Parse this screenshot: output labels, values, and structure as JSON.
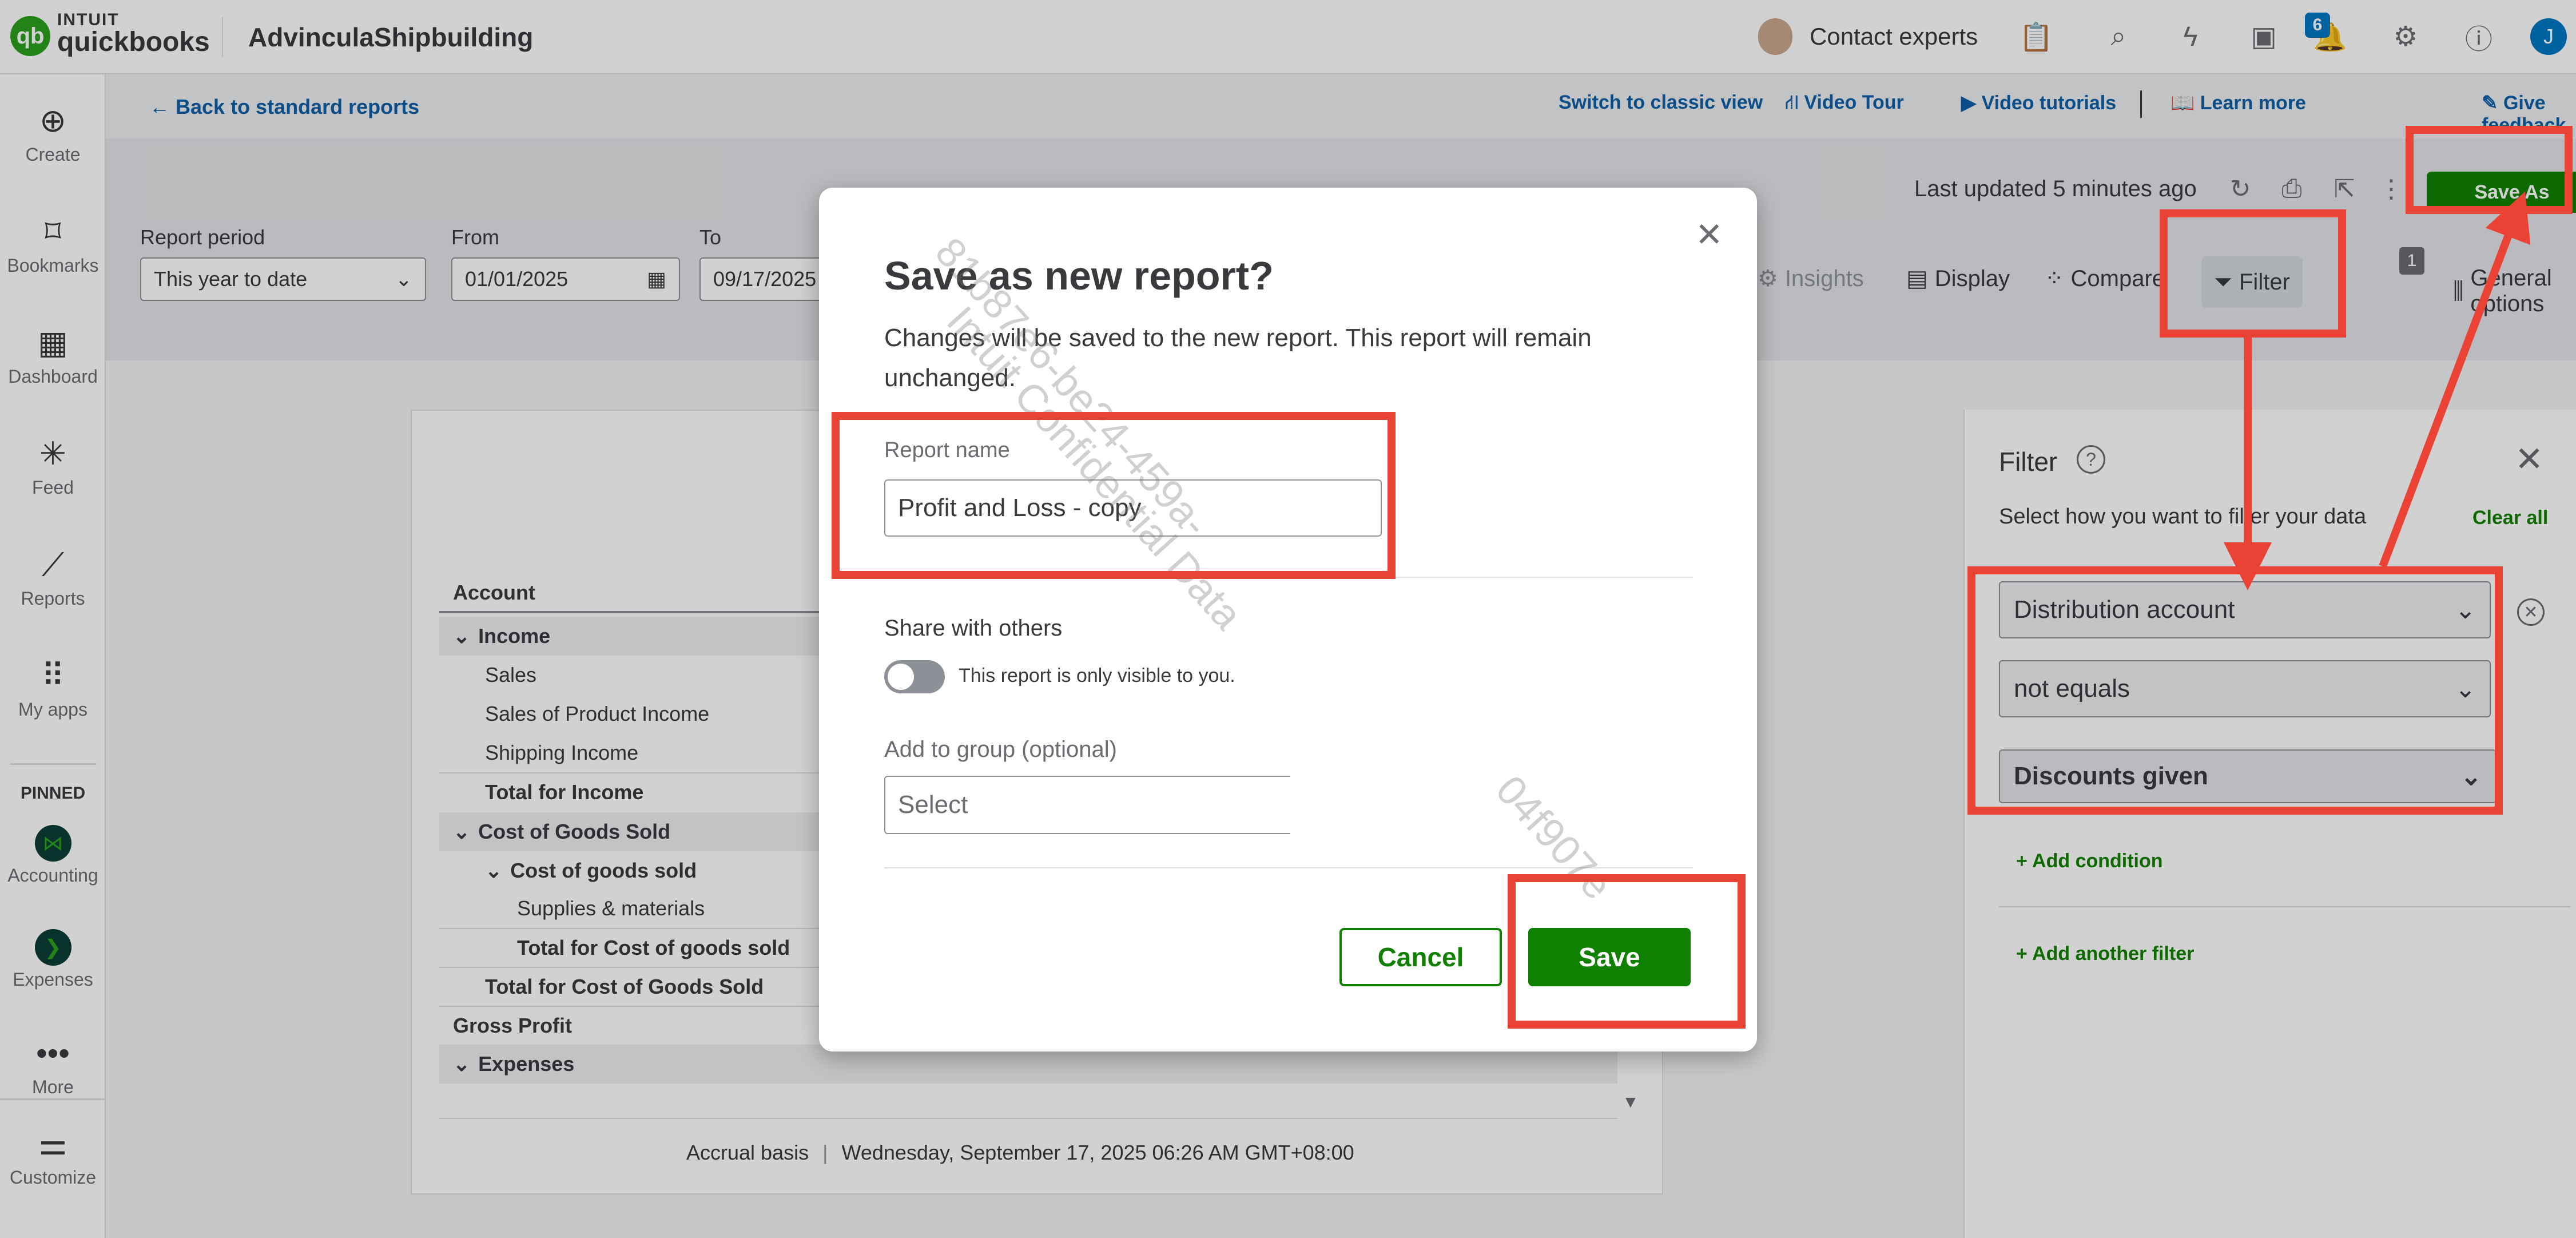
{
  "topbar": {
    "brand_top": "INTUIT",
    "brand_bottom": "quickbooks",
    "company": "AdvinculaShipbuilding",
    "contact_experts": "Contact experts",
    "notification_count": "6",
    "user_initial": "J"
  },
  "leftnav": {
    "items": [
      {
        "label": "Create"
      },
      {
        "label": "Bookmarks"
      },
      {
        "label": "Dashboard"
      },
      {
        "label": "Feed"
      },
      {
        "label": "Reports"
      },
      {
        "label": "My apps"
      }
    ],
    "pinned_label": "PINNED",
    "pinned": [
      {
        "label": "Accounting"
      },
      {
        "label": "Expenses"
      },
      {
        "label": "More"
      }
    ],
    "customize": "Customize"
  },
  "header": {
    "back_link": "Back to standard reports",
    "switch_classic": "Switch to classic view",
    "video_tour": "Video Tour",
    "video_tutorials": "Video tutorials",
    "learn_more": "Learn more",
    "give_feedback": "Give feedback"
  },
  "toolbar": {
    "last_updated": "Last updated 5 minutes ago",
    "save_as": "Save As",
    "report_period_label": "Report period",
    "report_period_value": "This year to date",
    "from_label": "From",
    "from_value": "01/01/2025",
    "to_label": "To",
    "to_value": "09/17/2025",
    "insights": "Insights",
    "display": "Display",
    "compare": "Compare",
    "filter": "Filter",
    "filter_count": "1",
    "general_options": "General options"
  },
  "report": {
    "account_header": "Account",
    "rows": [
      {
        "label": "Income"
      },
      {
        "label": "Sales"
      },
      {
        "label": "Sales of Product Income"
      },
      {
        "label": "Shipping Income"
      },
      {
        "label": "Total for Income"
      },
      {
        "label": "Cost of Goods Sold"
      },
      {
        "label": "Cost of goods sold"
      },
      {
        "label": "Supplies & materials"
      },
      {
        "label": "Total for Cost of goods sold"
      },
      {
        "label": "Total for Cost of Goods Sold"
      },
      {
        "label": "Gross Profit"
      },
      {
        "label": "Expenses"
      }
    ],
    "footer_basis": "Accrual basis",
    "footer_date": "Wednesday, September 17, 2025 06:26 AM GMT+08:00"
  },
  "filter_panel": {
    "title": "Filter",
    "subtitle": "Select how you want to filter your data",
    "clear_all": "Clear all",
    "field": "Distribution account",
    "operator": "not equals",
    "value": "Discounts given",
    "add_condition": "+ Add condition",
    "add_filter": "+ Add another filter"
  },
  "modal": {
    "title": "Save as new report?",
    "description": "Changes will be saved to the new report. This report will remain unchanged.",
    "report_name_label": "Report name",
    "report_name_value": "Profit and Loss - copy",
    "share_label": "Share with others",
    "share_hint": "This report is only visible to you.",
    "group_label": "Add to group (optional)",
    "group_placeholder": "Select",
    "cancel": "Cancel",
    "save": "Save"
  },
  "colors": {
    "brand_green": "#108000",
    "link_blue": "#0d5fa6",
    "annotation_red": "#ea4335"
  }
}
